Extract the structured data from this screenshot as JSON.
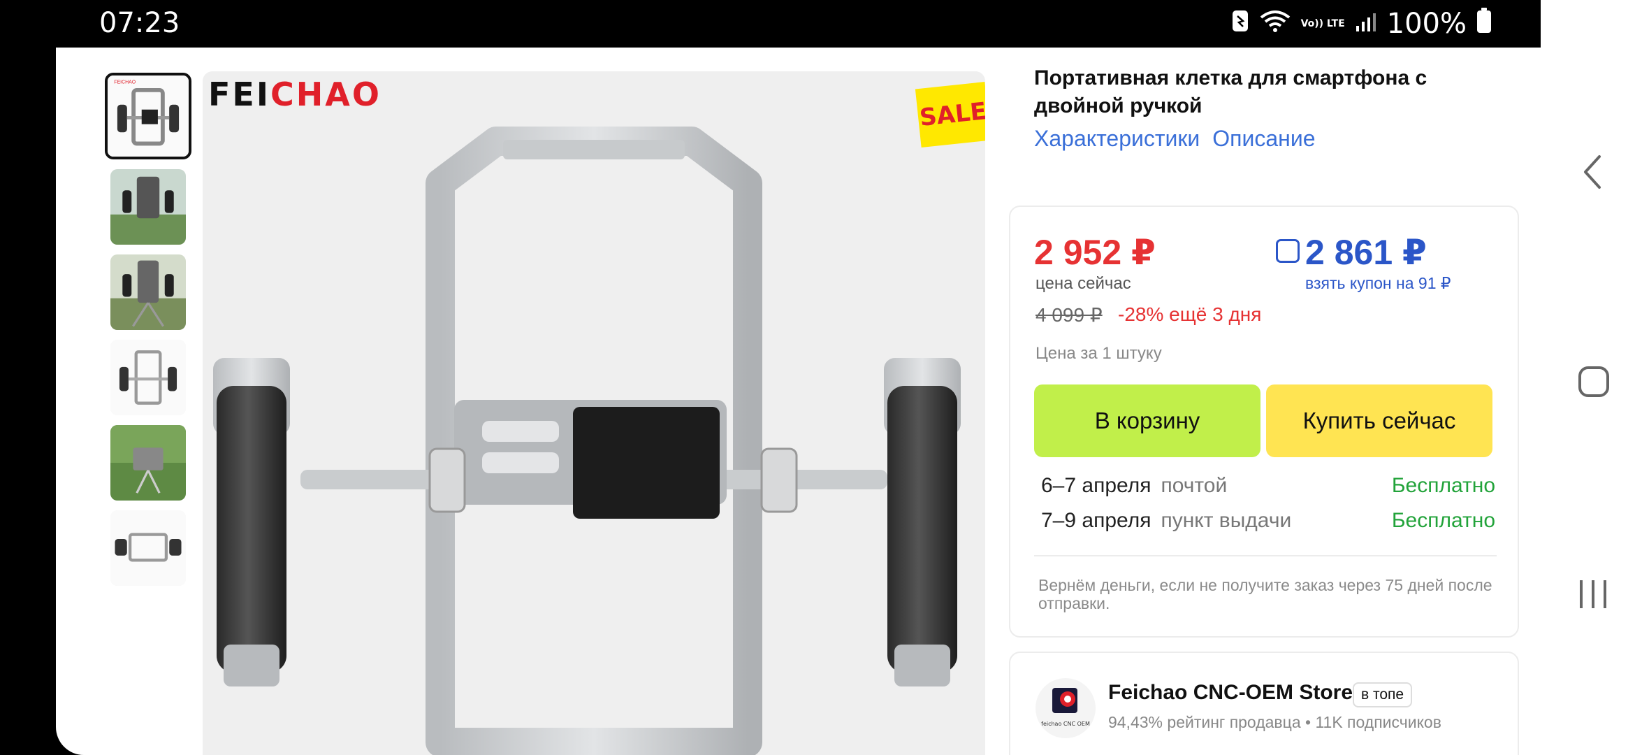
{
  "status_bar": {
    "time": "07:23",
    "battery": "100%",
    "icons": [
      "nfc-icon",
      "wifi-icon",
      "volte-icon",
      "signal-icon",
      "battery-icon"
    ],
    "volte_label": "Vo)) LTE"
  },
  "gallery": {
    "thumbnails": [
      "thumb-1",
      "thumb-2",
      "thumb-3",
      "thumb-4",
      "thumb-5",
      "thumb-6"
    ],
    "brand_part1": "FEI",
    "brand_part2": "CHAO",
    "sale_label": "SALE"
  },
  "product": {
    "title": "Портативная клетка для смартфона с двойной ручкой",
    "tabs": [
      "Характеристики",
      "Описание"
    ]
  },
  "pricing": {
    "price_now": "2 952 ₽",
    "price_now_label": "цена сейчас",
    "coupon_price": "2 861 ₽",
    "coupon_label": "взять купон на 91 ₽",
    "old_price": "4 099 ₽",
    "discount": "-28% ещё 3 дня",
    "unit_price": "Цена за 1 штуку",
    "add_to_cart": "В корзину",
    "buy_now": "Купить сейчас"
  },
  "shipping": [
    {
      "date": "6–7 апреля",
      "method": "почтой",
      "cost": "Бесплатно"
    },
    {
      "date": "7–9 апреля",
      "method": "пункт выдачи",
      "cost": "Бесплатно"
    }
  ],
  "refund_text": "Вернём деньги, если не получите заказ через 75 дней после отправки.",
  "store": {
    "name": "Feichao CNC-OEM Store",
    "badge": "в топе",
    "stats": "94,43% рейтинг продавца • 11K подписчиков",
    "logo_caption": "feichao CNC OEM"
  },
  "colors": {
    "price_red": "#e63233",
    "coupon_blue": "#2b56c8",
    "link_blue": "#3a6fd8",
    "cart_green": "#c1ef4a",
    "buy_yellow": "#ffe452",
    "free_green": "#22a33a"
  }
}
